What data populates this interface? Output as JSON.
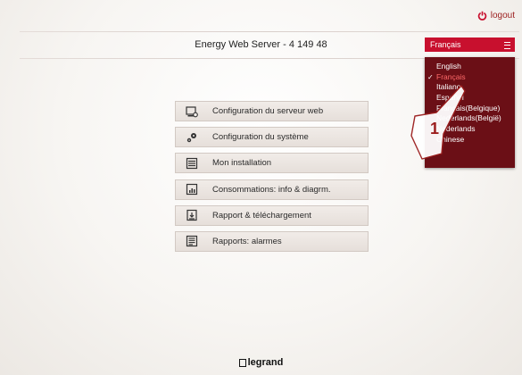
{
  "header": {
    "logout_label": "logout",
    "title": "Energy Web Server - 4 149 48"
  },
  "language": {
    "selected": "Français",
    "options": [
      {
        "label": "English",
        "selected": false
      },
      {
        "label": "Français",
        "selected": true
      },
      {
        "label": "Italiano",
        "selected": false
      },
      {
        "label": "Español",
        "selected": false
      },
      {
        "label": "Français(Belgique)",
        "selected": false
      },
      {
        "label": "Nederlands(België)",
        "selected": false
      },
      {
        "label": "Nederlands",
        "selected": false
      },
      {
        "label": "Chinese",
        "selected": false
      }
    ]
  },
  "annotation": {
    "step_number": "1"
  },
  "menu": {
    "items": [
      {
        "label": "Configuration du serveur web",
        "icon": "server-config-icon"
      },
      {
        "label": "Configuration du système",
        "icon": "gears-icon"
      },
      {
        "label": "Mon installation",
        "icon": "installation-icon"
      },
      {
        "label": "Consommations: info & diagrm.",
        "icon": "chart-icon"
      },
      {
        "label": "Rapport & téléchargement",
        "icon": "report-download-icon"
      },
      {
        "label": "Rapports: alarmes",
        "icon": "alarm-report-icon"
      }
    ]
  },
  "footer": {
    "brand": "legrand"
  },
  "colors": {
    "accent": "#c8102e",
    "dropdown_bg": "#6b0f16",
    "selected_text": "#ff6a6a"
  }
}
